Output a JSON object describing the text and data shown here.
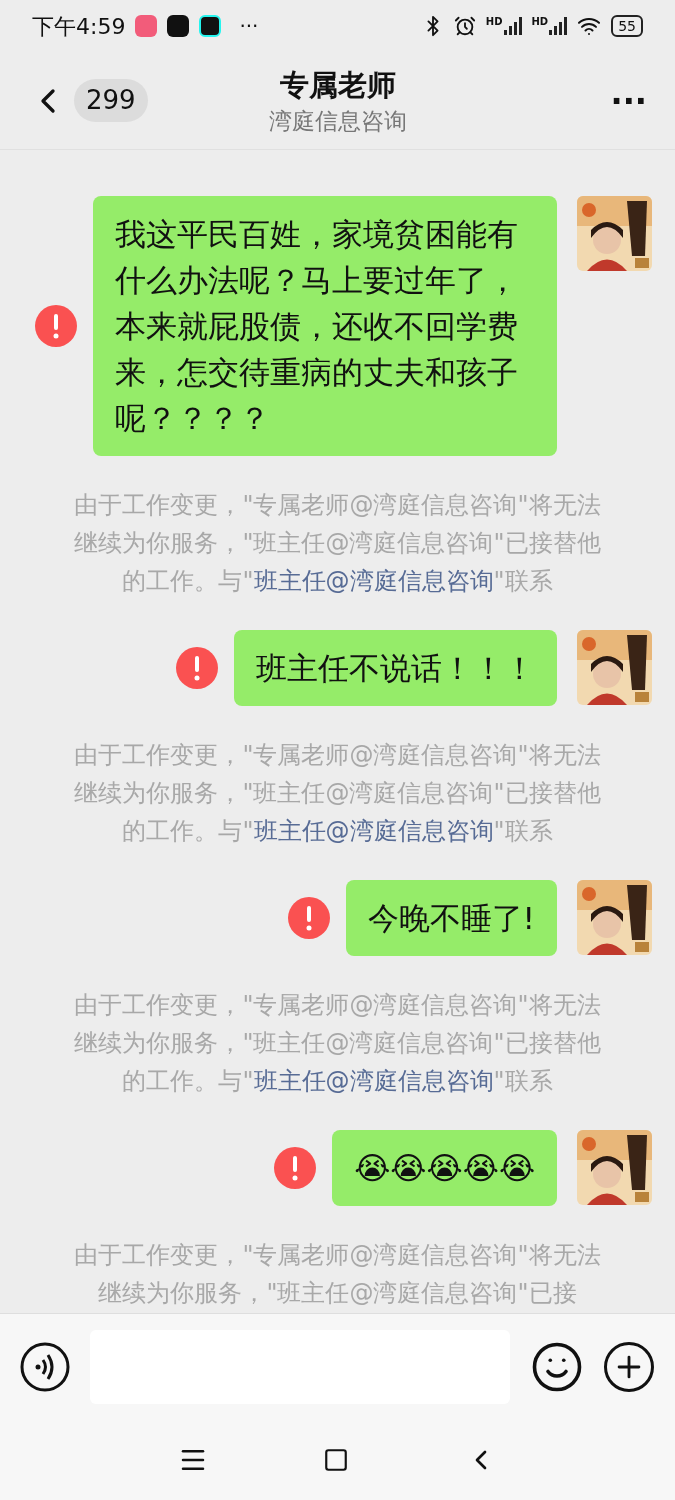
{
  "status_bar": {
    "time": "下午4:59",
    "more": "···",
    "signal_labels": [
      "HD",
      "HD"
    ],
    "battery": "55"
  },
  "header": {
    "badge": "299",
    "title": "专属老师",
    "subtitle": "湾庭信息咨询",
    "more": "···"
  },
  "messages": [
    {
      "kind": "outgoing",
      "text": "我这平民百姓，家境贫困能有什么办法呢？马上要过年了，本来就屁股债，还收不回学费来，怎交待重病的丈夫和孩子呢？？？？",
      "failed": true
    },
    {
      "kind": "notice",
      "parts": [
        {
          "text": "由于工作变更，\"专属老师@湾庭信息咨询\"将无法继续为你服务，\"班主任@湾庭信息咨询\"已接替他的工作。与\"",
          "link": false
        },
        {
          "text": "班主任@湾庭信息咨询",
          "link": true
        },
        {
          "text": "\"联系",
          "link": false
        }
      ]
    },
    {
      "kind": "outgoing",
      "text": "班主任不说话！！！",
      "failed": true
    },
    {
      "kind": "notice",
      "parts": [
        {
          "text": "由于工作变更，\"专属老师@湾庭信息咨询\"将无法继续为你服务，\"班主任@湾庭信息咨询\"已接替他的工作。与\"",
          "link": false
        },
        {
          "text": "班主任@湾庭信息咨询",
          "link": true
        },
        {
          "text": "\"联系",
          "link": false
        }
      ]
    },
    {
      "kind": "outgoing",
      "text": "今晚不睡了!",
      "failed": true
    },
    {
      "kind": "notice",
      "parts": [
        {
          "text": "由于工作变更，\"专属老师@湾庭信息咨询\"将无法继续为你服务，\"班主任@湾庭信息咨询\"已接替他的工作。与\"",
          "link": false
        },
        {
          "text": "班主任@湾庭信息咨询",
          "link": true
        },
        {
          "text": "\"联系",
          "link": false
        }
      ]
    },
    {
      "kind": "outgoing",
      "text": "😭😭😭😭😭",
      "failed": true
    },
    {
      "kind": "notice",
      "parts": [
        {
          "text": "由于工作变更，\"专属老师@湾庭信息咨询\"将无法继续为你服务，\"班主任@湾庭信息咨询\"已接",
          "link": false
        }
      ]
    }
  ]
}
